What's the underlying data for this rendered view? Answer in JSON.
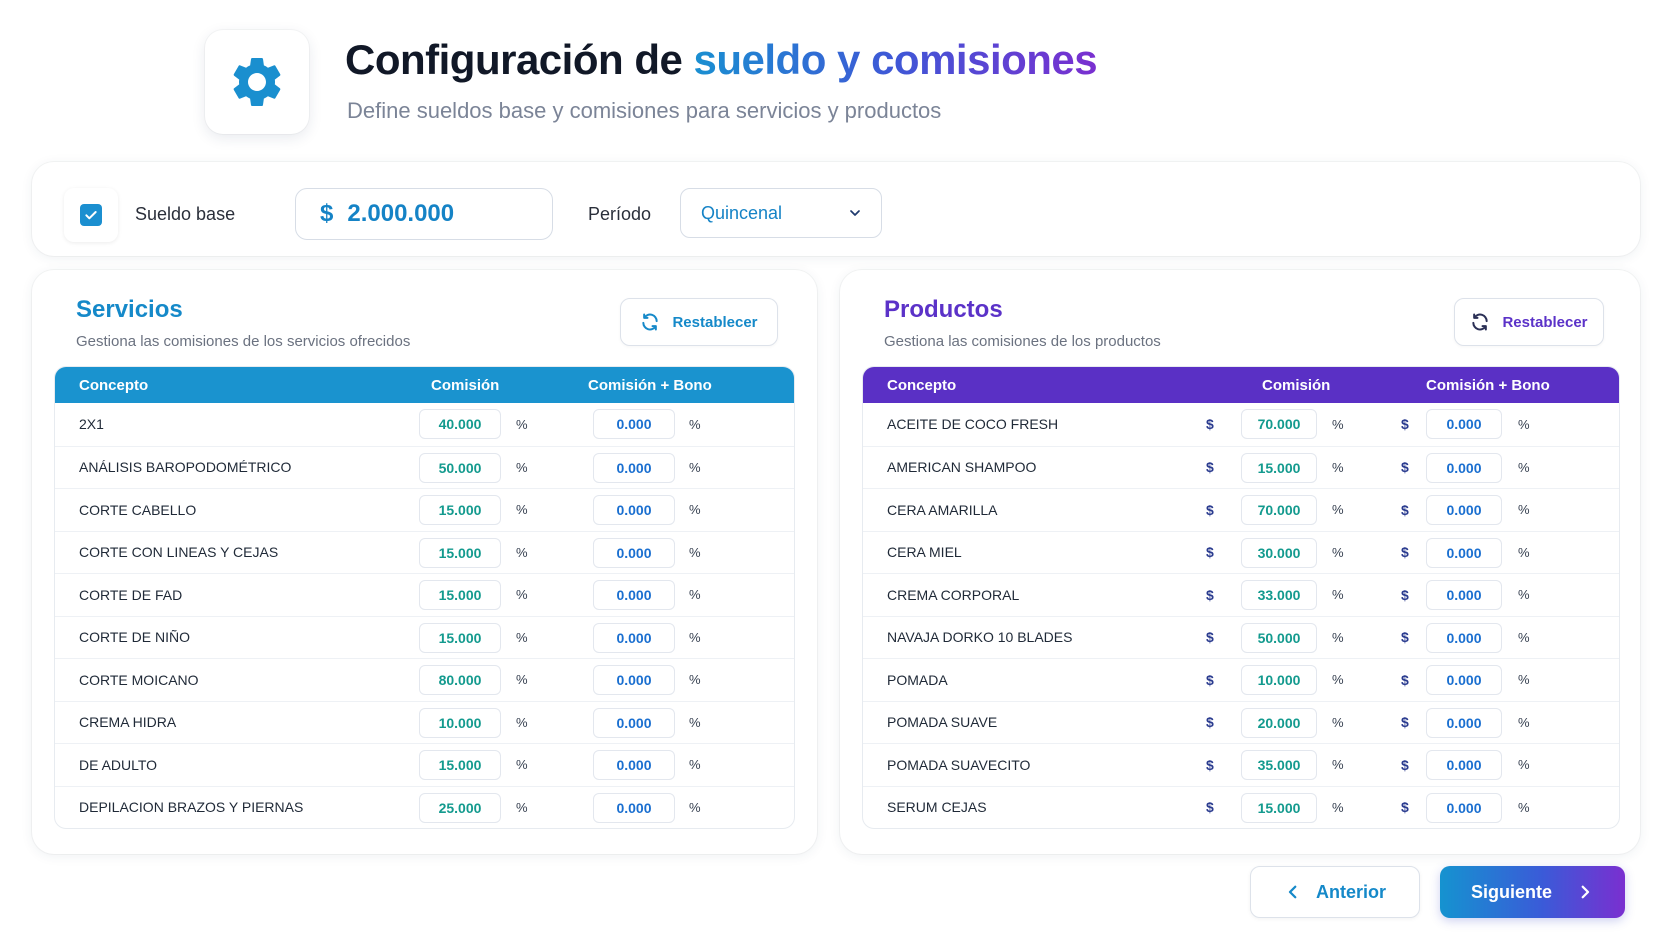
{
  "header": {
    "title_prefix": "Configuración de",
    "title_highlight": "sueldo y comisiones",
    "subtitle": "Define sueldos base y comisiones para servicios y productos",
    "icon": "gear-icon"
  },
  "base_salary": {
    "enabled": true,
    "label": "Sueldo base",
    "currency": "$",
    "amount": "2.000.000",
    "period_label": "Período",
    "period_value": "Quincenal"
  },
  "services": {
    "title": "Servicios",
    "subtitle": "Gestiona las comisiones de los servicios ofrecidos",
    "reset_label": "Restablecer",
    "columns": [
      "Concepto",
      "Comisión",
      "Comisión + Bono"
    ],
    "rows": [
      {
        "concept": "2X1",
        "commission": "40.000",
        "unit": "%",
        "bonus": "0.000",
        "bonus_unit": "%"
      },
      {
        "concept": "ANÁLISIS BAROPODOMÉTRICO",
        "commission": "50.000",
        "unit": "%",
        "bonus": "0.000",
        "bonus_unit": "%"
      },
      {
        "concept": "CORTE CABELLO",
        "commission": "15.000",
        "unit": "%",
        "bonus": "0.000",
        "bonus_unit": "%"
      },
      {
        "concept": "CORTE CON LINEAS Y CEJAS",
        "commission": "15.000",
        "unit": "%",
        "bonus": "0.000",
        "bonus_unit": "%"
      },
      {
        "concept": "CORTE DE FAD",
        "commission": "15.000",
        "unit": "%",
        "bonus": "0.000",
        "bonus_unit": "%"
      },
      {
        "concept": "CORTE DE NIÑO",
        "commission": "15.000",
        "unit": "%",
        "bonus": "0.000",
        "bonus_unit": "%"
      },
      {
        "concept": "CORTE MOICANO",
        "commission": "80.000",
        "unit": "%",
        "bonus": "0.000",
        "bonus_unit": "%"
      },
      {
        "concept": "CREMA HIDRA",
        "commission": "10.000",
        "unit": "%",
        "bonus": "0.000",
        "bonus_unit": "%"
      },
      {
        "concept": "DE ADULTO",
        "commission": "15.000",
        "unit": "%",
        "bonus": "0.000",
        "bonus_unit": "%"
      },
      {
        "concept": "DEPILACION BRAZOS Y PIERNAS",
        "commission": "25.000",
        "unit": "%",
        "bonus": "0.000",
        "bonus_unit": "%"
      }
    ]
  },
  "products": {
    "title": "Productos",
    "subtitle": "Gestiona las comisiones de los productos",
    "reset_label": "Restablecer",
    "columns": [
      "Concepto",
      "Comisión",
      "Comisión + Bono"
    ],
    "rows": [
      {
        "concept": "ACEITE DE COCO FRESH",
        "currency": "$",
        "commission": "70.000",
        "unit": "%",
        "bonus_currency": "$",
        "bonus": "0.000",
        "bonus_unit": "%"
      },
      {
        "concept": "AMERICAN SHAMPOO",
        "currency": "$",
        "commission": "15.000",
        "unit": "%",
        "bonus_currency": "$",
        "bonus": "0.000",
        "bonus_unit": "%"
      },
      {
        "concept": "CERA AMARILLA",
        "currency": "$",
        "commission": "70.000",
        "unit": "%",
        "bonus_currency": "$",
        "bonus": "0.000",
        "bonus_unit": "%"
      },
      {
        "concept": "CERA MIEL",
        "currency": "$",
        "commission": "30.000",
        "unit": "%",
        "bonus_currency": "$",
        "bonus": "0.000",
        "bonus_unit": "%"
      },
      {
        "concept": "CREMA CORPORAL",
        "currency": "$",
        "commission": "33.000",
        "unit": "%",
        "bonus_currency": "$",
        "bonus": "0.000",
        "bonus_unit": "%"
      },
      {
        "concept": "NAVAJA DORKO 10 BLADES",
        "currency": "$",
        "commission": "50.000",
        "unit": "%",
        "bonus_currency": "$",
        "bonus": "0.000",
        "bonus_unit": "%"
      },
      {
        "concept": "POMADA",
        "currency": "$",
        "commission": "10.000",
        "unit": "%",
        "bonus_currency": "$",
        "bonus": "0.000",
        "bonus_unit": "%"
      },
      {
        "concept": "POMADA SUAVE",
        "currency": "$",
        "commission": "20.000",
        "unit": "%",
        "bonus_currency": "$",
        "bonus": "0.000",
        "bonus_unit": "%"
      },
      {
        "concept": "POMADA SUAVECITO",
        "currency": "$",
        "commission": "35.000",
        "unit": "%",
        "bonus_currency": "$",
        "bonus": "0.000",
        "bonus_unit": "%"
      },
      {
        "concept": "SERUM CEJAS",
        "currency": "$",
        "commission": "15.000",
        "unit": "%",
        "bonus_currency": "$",
        "bonus": "0.000",
        "bonus_unit": "%"
      }
    ]
  },
  "navigation": {
    "prev_label": "Anterior",
    "next_label": "Siguiente"
  },
  "colors": {
    "services_accent": "#1a93cf",
    "products_accent": "#5a30c5",
    "commission_text": "#139a8e",
    "bonus_text": "#1a6fd0"
  }
}
